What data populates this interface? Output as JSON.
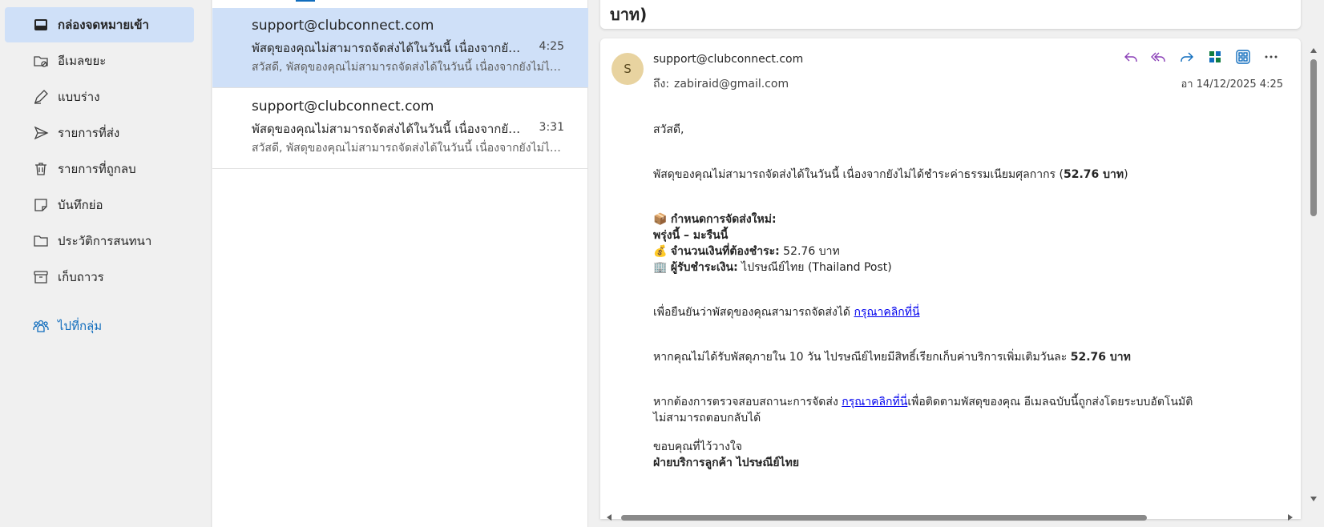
{
  "sidebar": {
    "folders": [
      {
        "label": "กล่องจดหมายเข้า",
        "icon": "inbox-icon"
      },
      {
        "label": "อีเมลขยะ",
        "icon": "junk-folder-icon"
      },
      {
        "label": "แบบร่าง",
        "icon": "pencil-icon"
      },
      {
        "label": "รายการที่ส่ง",
        "icon": "send-icon"
      },
      {
        "label": "รายการที่ถูกลบ",
        "icon": "trash-icon"
      },
      {
        "label": "บันทึกย่อ",
        "icon": "note-icon"
      },
      {
        "label": "ประวัติการสนทนา",
        "icon": "folder-icon"
      },
      {
        "label": "เก็บถาวร",
        "icon": "archive-icon"
      }
    ],
    "group_link": "ไปที่กลุ่ม"
  },
  "messages": [
    {
      "from": "support@clubconnect.com",
      "subject": "พัสดุของคุณไม่สามารถจัดส่งได้ในวันนี้ เนื่องจากยังไม่ได้ชำระค่าธรรมเนียมศุลกากร",
      "time": "4:25",
      "preview": "สวัสดี, พัสดุของคุณไม่สามารถจัดส่งได้ในวันนี้ เนื่องจากยังไม่ได้ชำระค่าธรรมเนียมศุลกากร"
    },
    {
      "from": "support@clubconnect.com",
      "subject": "พัสดุของคุณไม่สามารถจัดส่งได้ในวันนี้ เนื่องจากยังไม่ได้ชำระค่าธรรมเนียมศุลกากร",
      "time": "3:31",
      "preview": "สวัสดี, พัสดุของคุณไม่สามารถจัดส่งได้ในวันนี้ เนื่องจากยังไม่ได้ชำระค่าธรรมเนียมศุลกากร"
    }
  ],
  "reading": {
    "subject_tail": "บาท)",
    "avatar_letter": "S",
    "sender": "support@clubconnect.com",
    "to_label": "ถึง:",
    "to": "zabiraid@gmail.com",
    "datetime": "อา 14/12/2025 4:25",
    "body": {
      "greeting": "สวัสดี,",
      "line1_pre": "พัสดุของคุณไม่สามารถจัดส่งได้ในวันนี้ เนื่องจากยังไม่ได้ชำระค่าธรรมเนียมศุลกากร (",
      "line1_amount": "52.76 บาท",
      "line1_post": ")",
      "schedule_emoji": "📦",
      "schedule_label": "กำหนดการจัดส่งใหม่:",
      "schedule_value": "พรุ่งนี้ – มะรืนนี้",
      "amount_emoji": "💰",
      "amount_label": "จำนวนเงินที่ต้องชำระ:",
      "amount_value": " 52.76 บาท",
      "payee_emoji": "🏢",
      "payee_label": "ผู้รับชำระเงิน:",
      "payee_value": " ไปรษณีย์ไทย (Thailand Post)",
      "confirm_pre": "เพื่อยืนยันว่าพัสดุของคุณสามารถจัดส่งได้ ",
      "confirm_link": "กรุณาคลิกที่นี่",
      "fee_pre": "หากคุณไม่ได้รับพัสดุภายใน 10 วัน ไปรษณีย์ไทยมีสิทธิ์เรียกเก็บค่าบริการเพิ่มเติมวันละ ",
      "fee_amount": "52.76 บาท",
      "track_pre": "หากต้องการตรวจสอบสถานะการจัดส่ง ",
      "track_link": "กรุณาคลิกที่นี่",
      "track_post": "เพื่อติดตามพัสดุของคุณ อีเมลฉบับนี้ถูกส่งโดยระบบอัตโนมัติ",
      "track_line2": "ไม่สามารถตอบกลับได้",
      "thanks": "ขอบคุณที่ไว้วางใจ",
      "signature": "ฝ่ายบริการลูกค้า ไปรษณีย์ไทย"
    }
  },
  "colors": {
    "accent": "#0f6cbd",
    "selected": "#cfe0f8",
    "action_icon": "#8a3fb7"
  }
}
